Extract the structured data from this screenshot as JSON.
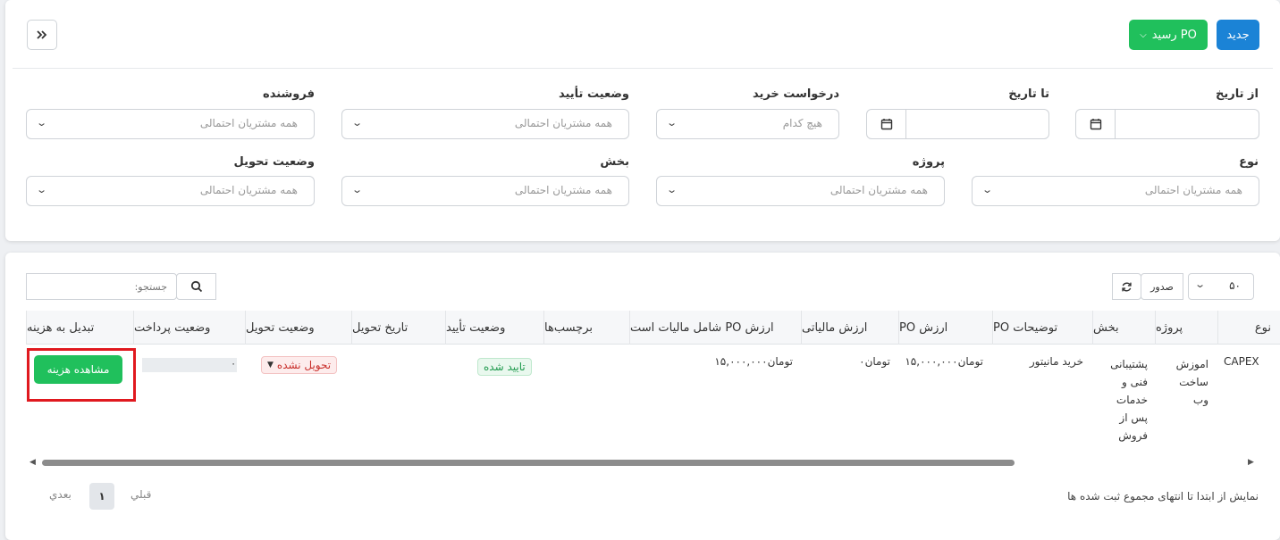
{
  "toolbar": {
    "new_label": "جدید",
    "receipt_label": "رسید PO",
    "collapse_icon": "double-chevron-icon"
  },
  "filters": {
    "from_date": {
      "label": "از تاریخ",
      "value": ""
    },
    "to_date": {
      "label": "تا تاریخ",
      "value": ""
    },
    "purchase_request": {
      "label": "درخواست خرید",
      "value": "هیچ کدام"
    },
    "approval_status": {
      "label": "وضعیت تأیید",
      "value": "همه مشتریان احتمالی"
    },
    "vendor": {
      "label": "فروشنده",
      "value": "همه مشتریان احتمالی"
    },
    "type": {
      "label": "نوع",
      "value": "همه مشتریان احتمالی"
    },
    "project": {
      "label": "پروژه",
      "value": "همه مشتریان احتمالی"
    },
    "department": {
      "label": "بخش",
      "value": "همه مشتریان احتمالی"
    },
    "delivery_status": {
      "label": "وضعیت تحویل",
      "value": "همه مشتریان احتمالی"
    }
  },
  "table_controls": {
    "page_size": "۵۰",
    "export_label": "صدور",
    "search_placeholder": "جستجو:"
  },
  "table": {
    "columns": [
      "نوع",
      "پروژه",
      "بخش",
      "توضیحات PO",
      "ارزش PO",
      "ارزش مالیاتی",
      "ارزش PO شامل مالیات است",
      "برچسب‌ها",
      "وضعیت تأیید",
      "تاریخ تحویل",
      "وضعیت تحویل",
      "وضعیت پرداخت",
      "تبدیل به هزینه"
    ],
    "row": {
      "type": "CAPEX",
      "project": "اموزش ساخت وب",
      "department": "پشتیبانی فنی و خدمات پس از فروش",
      "description": "خرید مانیتور",
      "po_value": "تومان۱۵,۰۰۰,۰۰۰",
      "tax_value": "تومان۰",
      "po_with_tax": "تومان۱۵,۰۰۰,۰۰۰",
      "approval": "تایید شده",
      "delivery": "تحویل نشده",
      "payment": "۰",
      "convert_button": "مشاهده هزینه"
    }
  },
  "footer": {
    "info": "نمایش از ابتدا تا انتهای مجموع ثبت شده ها",
    "prev": "قبلي",
    "page": "۱",
    "next": "بعدي"
  },
  "colors": {
    "primary": "#1b83d6",
    "success": "#20c05c",
    "highlight": "#e0191f"
  }
}
